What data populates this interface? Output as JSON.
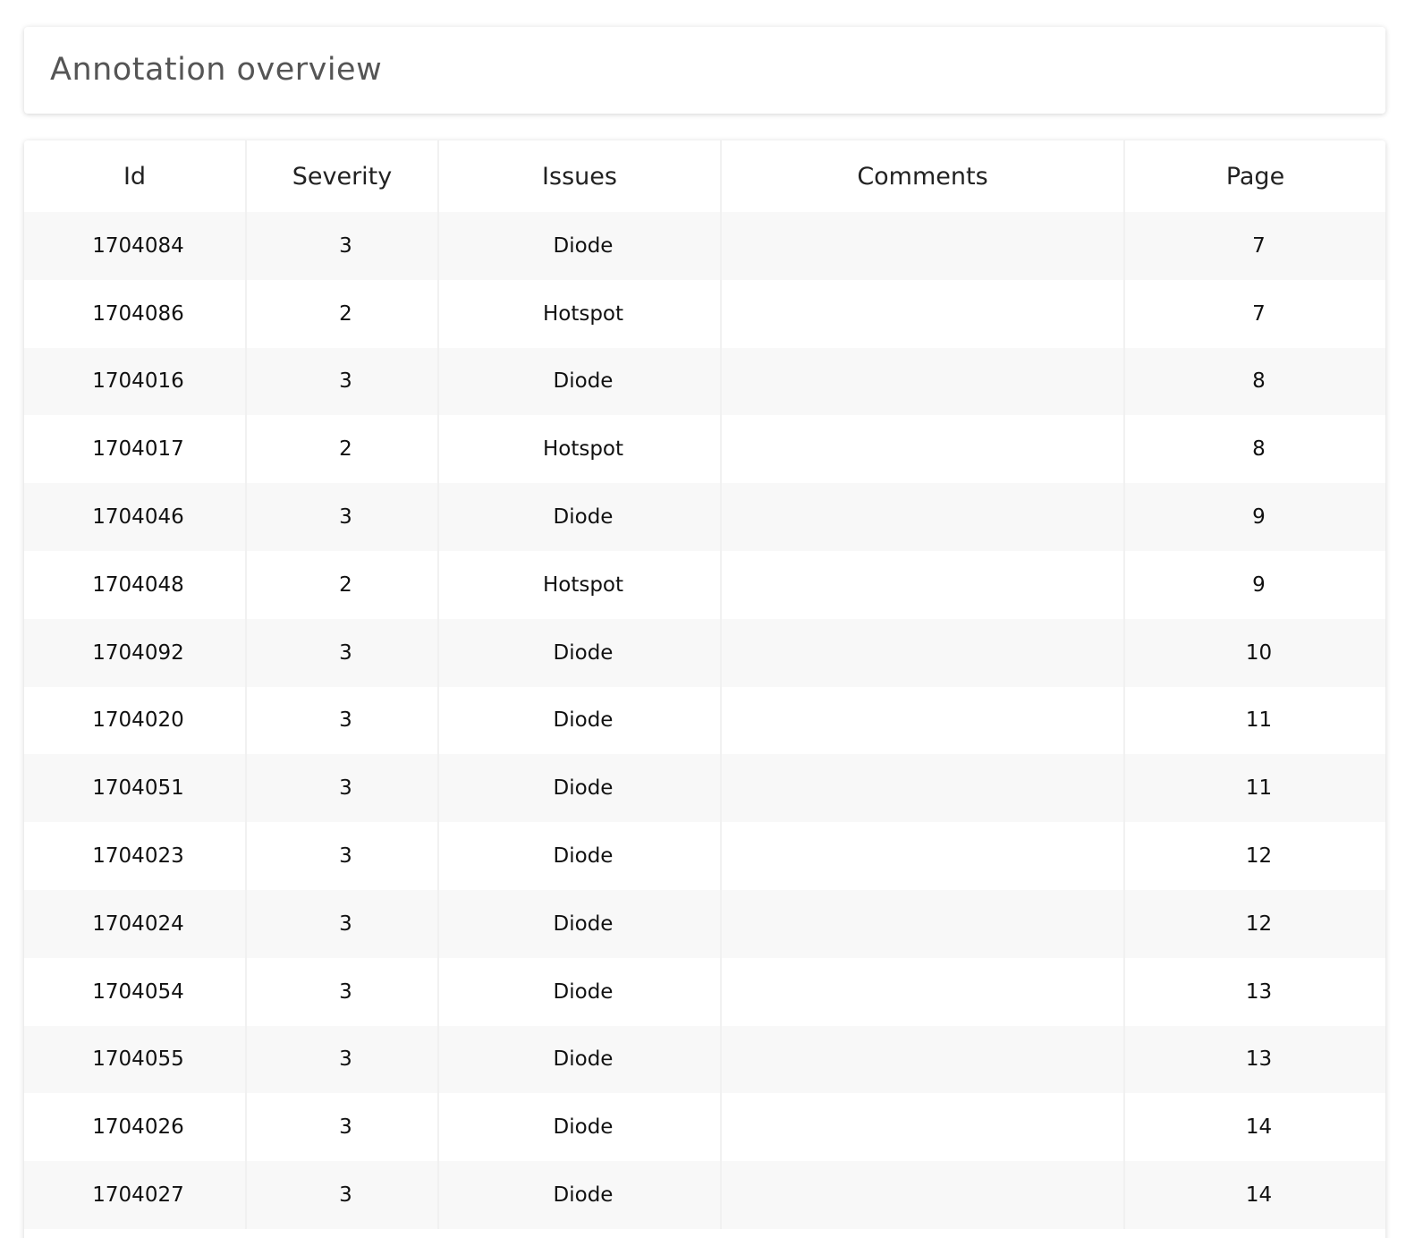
{
  "page": {
    "title": "Annotation overview"
  },
  "table": {
    "headers": [
      "Id",
      "Severity",
      "Issues",
      "Comments",
      "Page"
    ],
    "rows": [
      {
        "id": "1704084",
        "severity": "3",
        "issue": "Diode",
        "comment": "",
        "page": "7"
      },
      {
        "id": "1704086",
        "severity": "2",
        "issue": "Hotspot",
        "comment": "",
        "page": "7"
      },
      {
        "id": "1704016",
        "severity": "3",
        "issue": "Diode",
        "comment": "",
        "page": "8"
      },
      {
        "id": "1704017",
        "severity": "2",
        "issue": "Hotspot",
        "comment": "",
        "page": "8"
      },
      {
        "id": "1704046",
        "severity": "3",
        "issue": "Diode",
        "comment": "",
        "page": "9"
      },
      {
        "id": "1704048",
        "severity": "2",
        "issue": "Hotspot",
        "comment": "",
        "page": "9"
      },
      {
        "id": "1704092",
        "severity": "3",
        "issue": "Diode",
        "comment": "",
        "page": "10"
      },
      {
        "id": "1704020",
        "severity": "3",
        "issue": "Diode",
        "comment": "",
        "page": "11"
      },
      {
        "id": "1704051",
        "severity": "3",
        "issue": "Diode",
        "comment": "",
        "page": "11"
      },
      {
        "id": "1704023",
        "severity": "3",
        "issue": "Diode",
        "comment": "",
        "page": "12"
      },
      {
        "id": "1704024",
        "severity": "3",
        "issue": "Diode",
        "comment": "",
        "page": "12"
      },
      {
        "id": "1704054",
        "severity": "3",
        "issue": "Diode",
        "comment": "",
        "page": "13"
      },
      {
        "id": "1704055",
        "severity": "3",
        "issue": "Diode",
        "comment": "",
        "page": "13"
      },
      {
        "id": "1704026",
        "severity": "3",
        "issue": "Diode",
        "comment": "",
        "page": "14"
      },
      {
        "id": "1704027",
        "severity": "3",
        "issue": "Diode",
        "comment": "",
        "page": "14"
      }
    ]
  }
}
